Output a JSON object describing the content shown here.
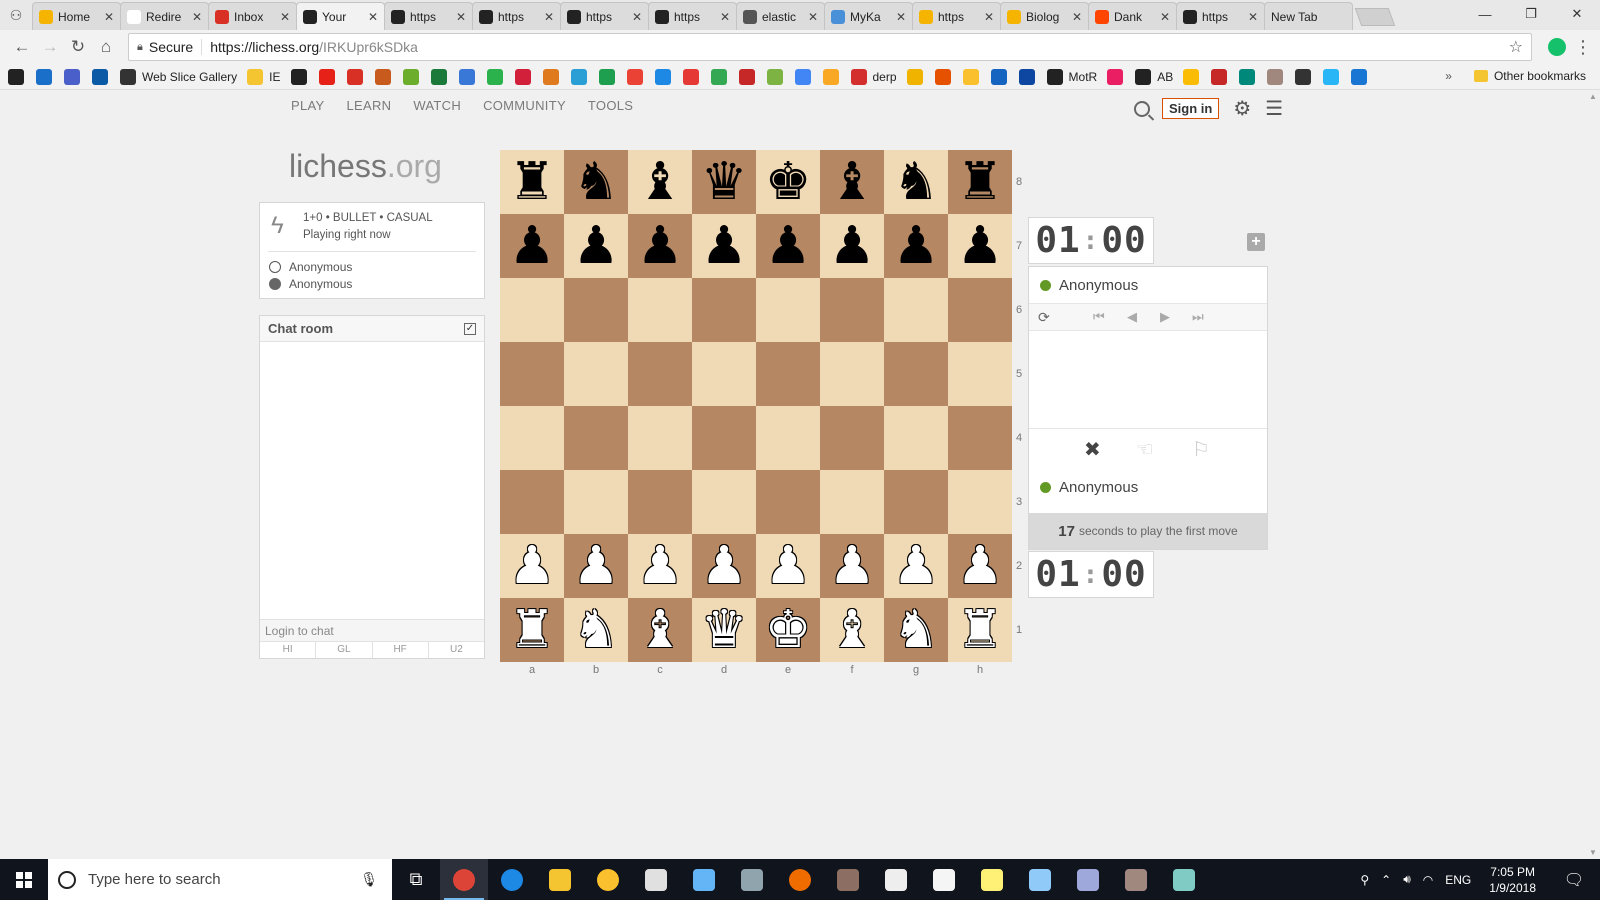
{
  "browser": {
    "tabs": [
      {
        "title": "Home",
        "color": "#f4b400",
        "icon": "generic-favicon-icon"
      },
      {
        "title": "Redire",
        "color": "#ffffff",
        "icon": "page-icon"
      },
      {
        "title": "Inbox",
        "color": "#d93025",
        "icon": "gmail-icon"
      },
      {
        "title": "Your",
        "color": "#222222",
        "icon": "lichess-knight-icon",
        "active": true
      },
      {
        "title": "https",
        "color": "#222222",
        "icon": "lichess-knight-icon"
      },
      {
        "title": "https",
        "color": "#222222",
        "icon": "lichess-knight-icon"
      },
      {
        "title": "https",
        "color": "#222222",
        "icon": "lichess-knight-icon"
      },
      {
        "title": "https",
        "color": "#222222",
        "icon": "lichess-knight-icon"
      },
      {
        "title": "elastic",
        "color": "#555555",
        "icon": "github-icon"
      },
      {
        "title": "MyKa",
        "color": "#4a90d9",
        "icon": "globe-icon"
      },
      {
        "title": "https",
        "color": "#f4b400",
        "icon": "generic-favicon-icon"
      },
      {
        "title": "Biolog",
        "color": "#f4b400",
        "icon": "generic-favicon-icon"
      },
      {
        "title": "Dank",
        "color": "#ff4500",
        "icon": "reddit-icon"
      },
      {
        "title": "https",
        "color": "#222222",
        "icon": "lichess-knight-icon"
      },
      {
        "title": "New Tab",
        "color": "",
        "icon": ""
      }
    ],
    "address": {
      "secure_label": "Secure",
      "host": "https://lichess.org",
      "path": "/IRKUpr6kSDka"
    },
    "bookmarks": {
      "web_slice": "Web Slice Gallery",
      "ie": "IE",
      "derp": "derp",
      "motr": "MotR",
      "ab": "AB",
      "other": "Other bookmarks"
    }
  },
  "site": {
    "nav": [
      "PLAY",
      "LEARN",
      "WATCH",
      "COMMUNITY",
      "TOOLS"
    ],
    "signin": "Sign in",
    "logo_main": "lichess",
    "logo_tld": ".org"
  },
  "game": {
    "setup": "1+0 • BULLET • CASUAL",
    "status": "Playing right now",
    "white_player": "Anonymous",
    "black_player": "Anonymous"
  },
  "chat": {
    "title": "Chat room",
    "placeholder": "Login to chat",
    "presets": [
      "HI",
      "GL",
      "HF",
      "U2"
    ]
  },
  "board": {
    "ranks": [
      "8",
      "7",
      "6",
      "5",
      "4",
      "3",
      "2",
      "1"
    ],
    "files": [
      "a",
      "b",
      "c",
      "d",
      "e",
      "f",
      "g",
      "h"
    ],
    "colors": {
      "light": "#f0d9b5",
      "dark": "#b58863"
    }
  },
  "clocks": {
    "top": {
      "min": "01",
      "sec": "00"
    },
    "bottom": {
      "min": "01",
      "sec": "00"
    }
  },
  "panel": {
    "top_player": "Anonymous",
    "bottom_player": "Anonymous",
    "first_move_seconds": "17",
    "first_move_text": "seconds to play the first move"
  },
  "taskbar": {
    "search_placeholder": "Type here to search",
    "lang": "ENG",
    "time": "7:05 PM",
    "date": "1/9/2018"
  }
}
